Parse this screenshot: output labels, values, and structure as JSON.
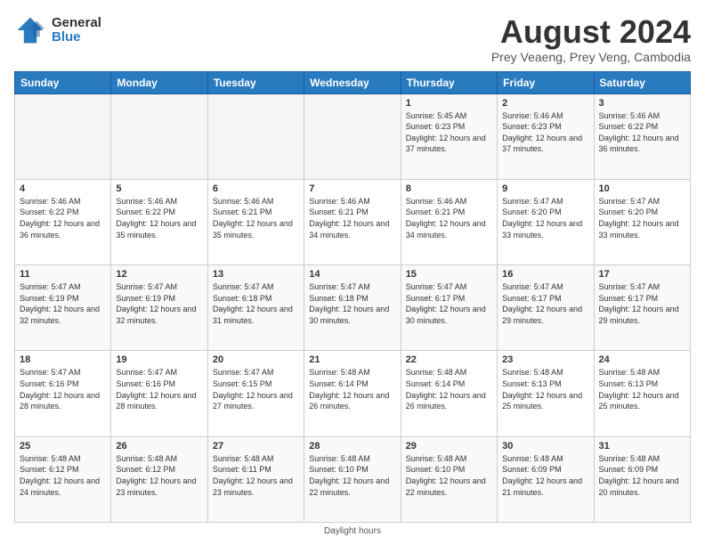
{
  "logo": {
    "general": "General",
    "blue": "Blue"
  },
  "title": "August 2024",
  "subtitle": "Prey Veaeng, Prey Veng, Cambodia",
  "headers": [
    "Sunday",
    "Monday",
    "Tuesday",
    "Wednesday",
    "Thursday",
    "Friday",
    "Saturday"
  ],
  "footer": "Daylight hours",
  "weeks": [
    [
      {
        "day": "",
        "sunrise": "",
        "sunset": "",
        "daylight": ""
      },
      {
        "day": "",
        "sunrise": "",
        "sunset": "",
        "daylight": ""
      },
      {
        "day": "",
        "sunrise": "",
        "sunset": "",
        "daylight": ""
      },
      {
        "day": "",
        "sunrise": "",
        "sunset": "",
        "daylight": ""
      },
      {
        "day": "1",
        "sunrise": "Sunrise: 5:45 AM",
        "sunset": "Sunset: 6:23 PM",
        "daylight": "Daylight: 12 hours and 37 minutes."
      },
      {
        "day": "2",
        "sunrise": "Sunrise: 5:46 AM",
        "sunset": "Sunset: 6:23 PM",
        "daylight": "Daylight: 12 hours and 37 minutes."
      },
      {
        "day": "3",
        "sunrise": "Sunrise: 5:46 AM",
        "sunset": "Sunset: 6:22 PM",
        "daylight": "Daylight: 12 hours and 36 minutes."
      }
    ],
    [
      {
        "day": "4",
        "sunrise": "Sunrise: 5:46 AM",
        "sunset": "Sunset: 6:22 PM",
        "daylight": "Daylight: 12 hours and 36 minutes."
      },
      {
        "day": "5",
        "sunrise": "Sunrise: 5:46 AM",
        "sunset": "Sunset: 6:22 PM",
        "daylight": "Daylight: 12 hours and 35 minutes."
      },
      {
        "day": "6",
        "sunrise": "Sunrise: 5:46 AM",
        "sunset": "Sunset: 6:21 PM",
        "daylight": "Daylight: 12 hours and 35 minutes."
      },
      {
        "day": "7",
        "sunrise": "Sunrise: 5:46 AM",
        "sunset": "Sunset: 6:21 PM",
        "daylight": "Daylight: 12 hours and 34 minutes."
      },
      {
        "day": "8",
        "sunrise": "Sunrise: 5:46 AM",
        "sunset": "Sunset: 6:21 PM",
        "daylight": "Daylight: 12 hours and 34 minutes."
      },
      {
        "day": "9",
        "sunrise": "Sunrise: 5:47 AM",
        "sunset": "Sunset: 6:20 PM",
        "daylight": "Daylight: 12 hours and 33 minutes."
      },
      {
        "day": "10",
        "sunrise": "Sunrise: 5:47 AM",
        "sunset": "Sunset: 6:20 PM",
        "daylight": "Daylight: 12 hours and 33 minutes."
      }
    ],
    [
      {
        "day": "11",
        "sunrise": "Sunrise: 5:47 AM",
        "sunset": "Sunset: 6:19 PM",
        "daylight": "Daylight: 12 hours and 32 minutes."
      },
      {
        "day": "12",
        "sunrise": "Sunrise: 5:47 AM",
        "sunset": "Sunset: 6:19 PM",
        "daylight": "Daylight: 12 hours and 32 minutes."
      },
      {
        "day": "13",
        "sunrise": "Sunrise: 5:47 AM",
        "sunset": "Sunset: 6:18 PM",
        "daylight": "Daylight: 12 hours and 31 minutes."
      },
      {
        "day": "14",
        "sunrise": "Sunrise: 5:47 AM",
        "sunset": "Sunset: 6:18 PM",
        "daylight": "Daylight: 12 hours and 30 minutes."
      },
      {
        "day": "15",
        "sunrise": "Sunrise: 5:47 AM",
        "sunset": "Sunset: 6:17 PM",
        "daylight": "Daylight: 12 hours and 30 minutes."
      },
      {
        "day": "16",
        "sunrise": "Sunrise: 5:47 AM",
        "sunset": "Sunset: 6:17 PM",
        "daylight": "Daylight: 12 hours and 29 minutes."
      },
      {
        "day": "17",
        "sunrise": "Sunrise: 5:47 AM",
        "sunset": "Sunset: 6:17 PM",
        "daylight": "Daylight: 12 hours and 29 minutes."
      }
    ],
    [
      {
        "day": "18",
        "sunrise": "Sunrise: 5:47 AM",
        "sunset": "Sunset: 6:16 PM",
        "daylight": "Daylight: 12 hours and 28 minutes."
      },
      {
        "day": "19",
        "sunrise": "Sunrise: 5:47 AM",
        "sunset": "Sunset: 6:16 PM",
        "daylight": "Daylight: 12 hours and 28 minutes."
      },
      {
        "day": "20",
        "sunrise": "Sunrise: 5:47 AM",
        "sunset": "Sunset: 6:15 PM",
        "daylight": "Daylight: 12 hours and 27 minutes."
      },
      {
        "day": "21",
        "sunrise": "Sunrise: 5:48 AM",
        "sunset": "Sunset: 6:14 PM",
        "daylight": "Daylight: 12 hours and 26 minutes."
      },
      {
        "day": "22",
        "sunrise": "Sunrise: 5:48 AM",
        "sunset": "Sunset: 6:14 PM",
        "daylight": "Daylight: 12 hours and 26 minutes."
      },
      {
        "day": "23",
        "sunrise": "Sunrise: 5:48 AM",
        "sunset": "Sunset: 6:13 PM",
        "daylight": "Daylight: 12 hours and 25 minutes."
      },
      {
        "day": "24",
        "sunrise": "Sunrise: 5:48 AM",
        "sunset": "Sunset: 6:13 PM",
        "daylight": "Daylight: 12 hours and 25 minutes."
      }
    ],
    [
      {
        "day": "25",
        "sunrise": "Sunrise: 5:48 AM",
        "sunset": "Sunset: 6:12 PM",
        "daylight": "Daylight: 12 hours and 24 minutes."
      },
      {
        "day": "26",
        "sunrise": "Sunrise: 5:48 AM",
        "sunset": "Sunset: 6:12 PM",
        "daylight": "Daylight: 12 hours and 23 minutes."
      },
      {
        "day": "27",
        "sunrise": "Sunrise: 5:48 AM",
        "sunset": "Sunset: 6:11 PM",
        "daylight": "Daylight: 12 hours and 23 minutes."
      },
      {
        "day": "28",
        "sunrise": "Sunrise: 5:48 AM",
        "sunset": "Sunset: 6:10 PM",
        "daylight": "Daylight: 12 hours and 22 minutes."
      },
      {
        "day": "29",
        "sunrise": "Sunrise: 5:48 AM",
        "sunset": "Sunset: 6:10 PM",
        "daylight": "Daylight: 12 hours and 22 minutes."
      },
      {
        "day": "30",
        "sunrise": "Sunrise: 5:48 AM",
        "sunset": "Sunset: 6:09 PM",
        "daylight": "Daylight: 12 hours and 21 minutes."
      },
      {
        "day": "31",
        "sunrise": "Sunrise: 5:48 AM",
        "sunset": "Sunset: 6:09 PM",
        "daylight": "Daylight: 12 hours and 20 minutes."
      }
    ]
  ]
}
